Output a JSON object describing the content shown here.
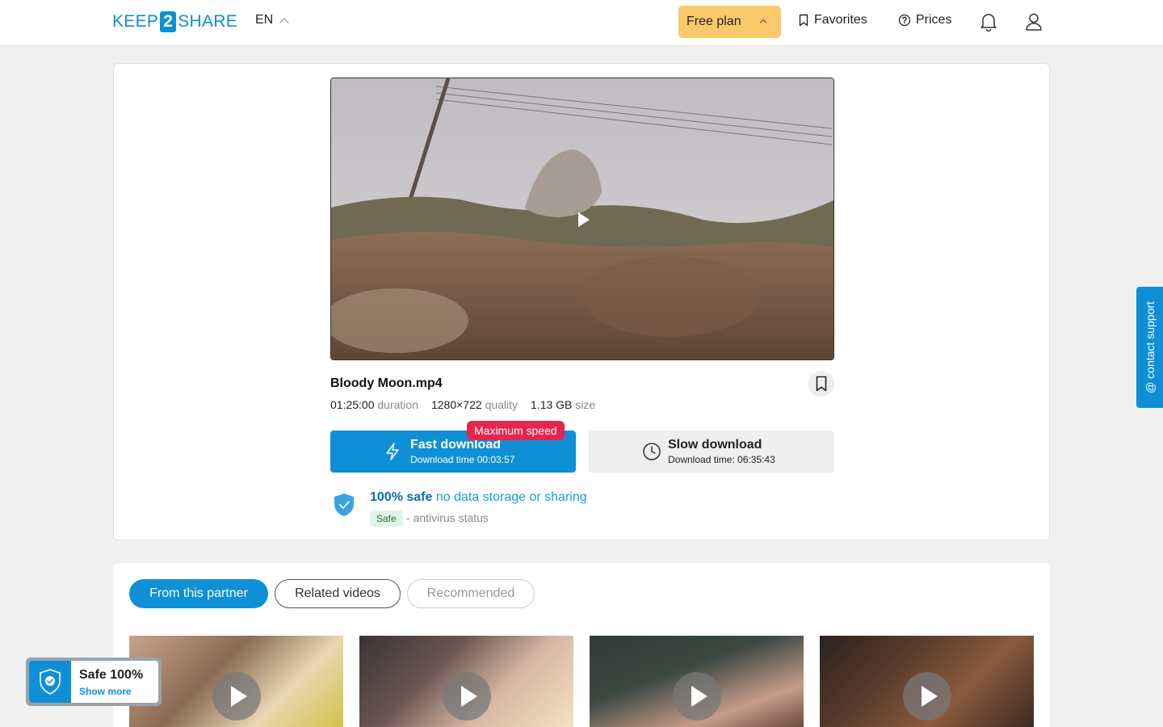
{
  "header": {
    "logo_left": "KEEP",
    "logo_mid": "2",
    "logo_right": "SHARE",
    "lang": "EN",
    "plan_label": "Free plan",
    "favorites_label": "Favorites",
    "prices_label": "Prices"
  },
  "file": {
    "name": "Bloody Moon.mp4",
    "duration_value": "01:25:00",
    "duration_label": "duration",
    "quality_value": "1280×722",
    "quality_label": "quality",
    "size_value": "1.13 GB",
    "size_label": "size"
  },
  "download": {
    "fast_label": "Fast download",
    "fast_time": "Download time 00:03:57",
    "max_badge": "Maximum speed",
    "slow_label": "Slow download",
    "slow_time": "Download time: 06:35:43"
  },
  "safety": {
    "strong": "100% safe",
    "rest": "no data storage or sharing",
    "tag": "Safe",
    "status": "- antivirus status"
  },
  "tabs": [
    {
      "label": "From this partner"
    },
    {
      "label": "Related videos"
    },
    {
      "label": "Recommended"
    }
  ],
  "safe_widget": {
    "title": "Safe 100%",
    "link": "Show more"
  },
  "support": {
    "label": "@ contact support"
  },
  "colors": {
    "accent": "#0e8fd6",
    "plan": "#f9c96c",
    "badge": "#e5254c"
  }
}
